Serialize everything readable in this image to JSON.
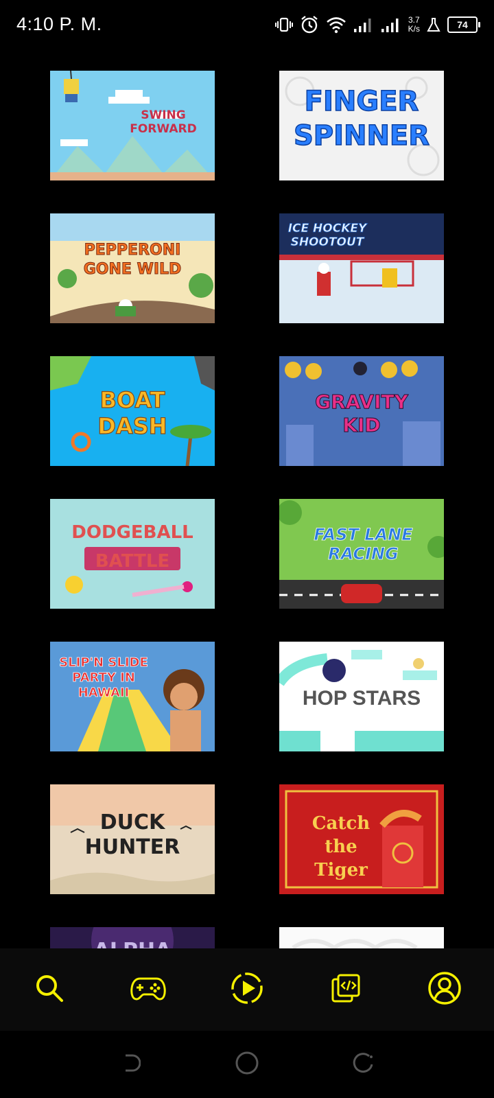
{
  "status_bar": {
    "time": "4:10 P. M.",
    "net_speed_value": "3.7",
    "net_speed_unit": "K/s",
    "battery_level": "74",
    "icons": [
      "vibrate-icon",
      "alarm-icon",
      "wifi-icon",
      "signal-icon",
      "signal-icon",
      "lab-icon",
      "battery-icon"
    ]
  },
  "games": [
    {
      "title": "SWING FORWARD"
    },
    {
      "title": "FINGER SPINNER"
    },
    {
      "title": "PEPPERONI GONE WILD"
    },
    {
      "title": "ICE HOCKEY SHOOTOUT"
    },
    {
      "title": "BOAT DASH"
    },
    {
      "title": "GRAVITY KID"
    },
    {
      "title": "DODGEBALL BATTLE"
    },
    {
      "title": "FAST LANE RACING"
    },
    {
      "title": "SLIP'N SLIDE PARTY IN HAWAII"
    },
    {
      "title": "HOP STARS"
    },
    {
      "title": "DUCK HUNTER"
    },
    {
      "title": "Catch the Tiger"
    },
    {
      "title": "ALPHA"
    },
    {
      "title": ""
    }
  ],
  "bottom_nav": {
    "accent_color": "#f5f000",
    "items": [
      "search-icon",
      "gamepad-icon",
      "play-icon",
      "code-icon",
      "profile-icon"
    ]
  },
  "system_nav": [
    "back-icon",
    "home-icon",
    "recents-icon"
  ]
}
